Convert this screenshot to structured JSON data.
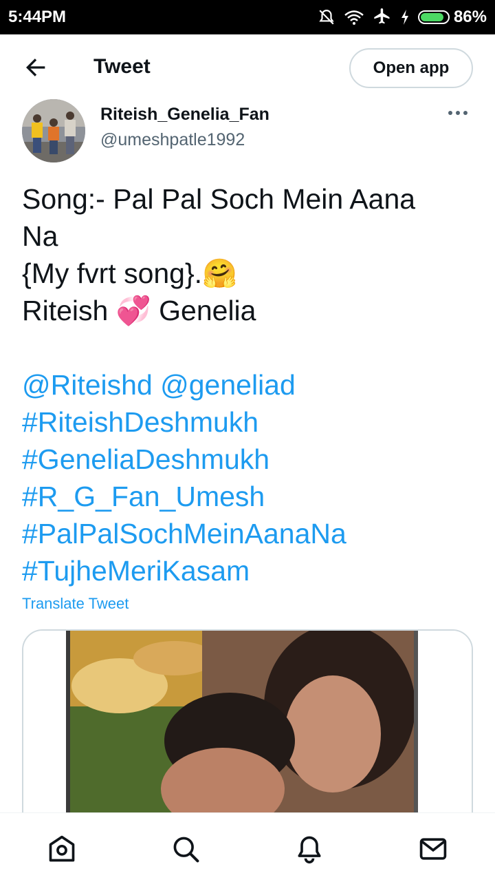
{
  "status_bar": {
    "time": "5:44PM",
    "battery": "86%",
    "battery_level": 0.86,
    "icons": [
      "bell-muted-icon",
      "wifi-icon",
      "airplane-icon",
      "charging-icon",
      "battery-icon"
    ]
  },
  "header": {
    "title": "Tweet",
    "open_app_label": "Open app",
    "back_icon": "back-arrow-icon"
  },
  "author": {
    "name": "Riteish_Genelia_Fan",
    "handle": "@umeshpatle1992"
  },
  "tweet": {
    "lines": [
      "Song:- Pal Pal Soch Mein Aana",
      "Na",
      "{My fvrt song}.🤗",
      "Riteish 💞 Genelia"
    ],
    "links": [
      "@Riteishd @geneliad",
      "#RiteishDeshmukh",
      "#GeneliaDeshmukh",
      "#R_G_Fan_Umesh",
      "#PalPalSochMeinAanaNa",
      "#TujheMeriKasam"
    ],
    "translate_label": "Translate Tweet"
  },
  "bottom_nav": [
    "home-icon",
    "search-icon",
    "notifications-icon",
    "messages-icon"
  ],
  "colors": {
    "link": "#1d9bf0",
    "text": "#0f1419",
    "muted": "#536471"
  }
}
